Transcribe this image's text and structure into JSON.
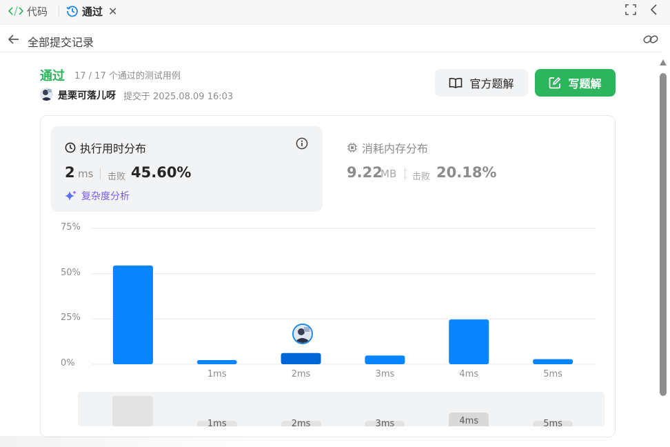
{
  "tabs": {
    "code_label": "代码",
    "result_label": "通过"
  },
  "header": {
    "back_title": "全部提交记录"
  },
  "submission": {
    "status": "通过",
    "cases": "17 / 17 个通过的测试用例",
    "username": "是栗可落儿呀",
    "submitted_at": "提交于 2025.08.09 16:03"
  },
  "buttons": {
    "official": "官方题解",
    "write": "写题解"
  },
  "runtime": {
    "title": "执行用时分布",
    "value": "2",
    "unit": "ms",
    "beats_label": "击败",
    "beats": "45.60%",
    "complexity_link": "复杂度分析"
  },
  "memory": {
    "title": "消耗内存分布",
    "value": "9.22",
    "unit": "MB",
    "beats_label": "击败",
    "beats": "20.18%"
  },
  "navigator": {
    "labels": [
      "1ms",
      "2ms",
      "3ms",
      "4ms",
      "5ms"
    ]
  },
  "colors": {
    "accent_green": "#2db55d",
    "bar_blue": "#0a84ff",
    "bar_selected": "#0066d6",
    "purple_link": "#7a59f5"
  },
  "chart_data": {
    "type": "bar",
    "categories": [
      "",
      "1ms",
      "2ms",
      "3ms",
      "4ms",
      "5ms"
    ],
    "values": [
      54.5,
      2.3,
      6.2,
      4.8,
      24.7,
      2.8
    ],
    "selected_index": 2,
    "yticks": [
      "0%",
      "25%",
      "50%",
      "75%"
    ],
    "ylim": [
      0,
      75
    ],
    "grid": true
  }
}
